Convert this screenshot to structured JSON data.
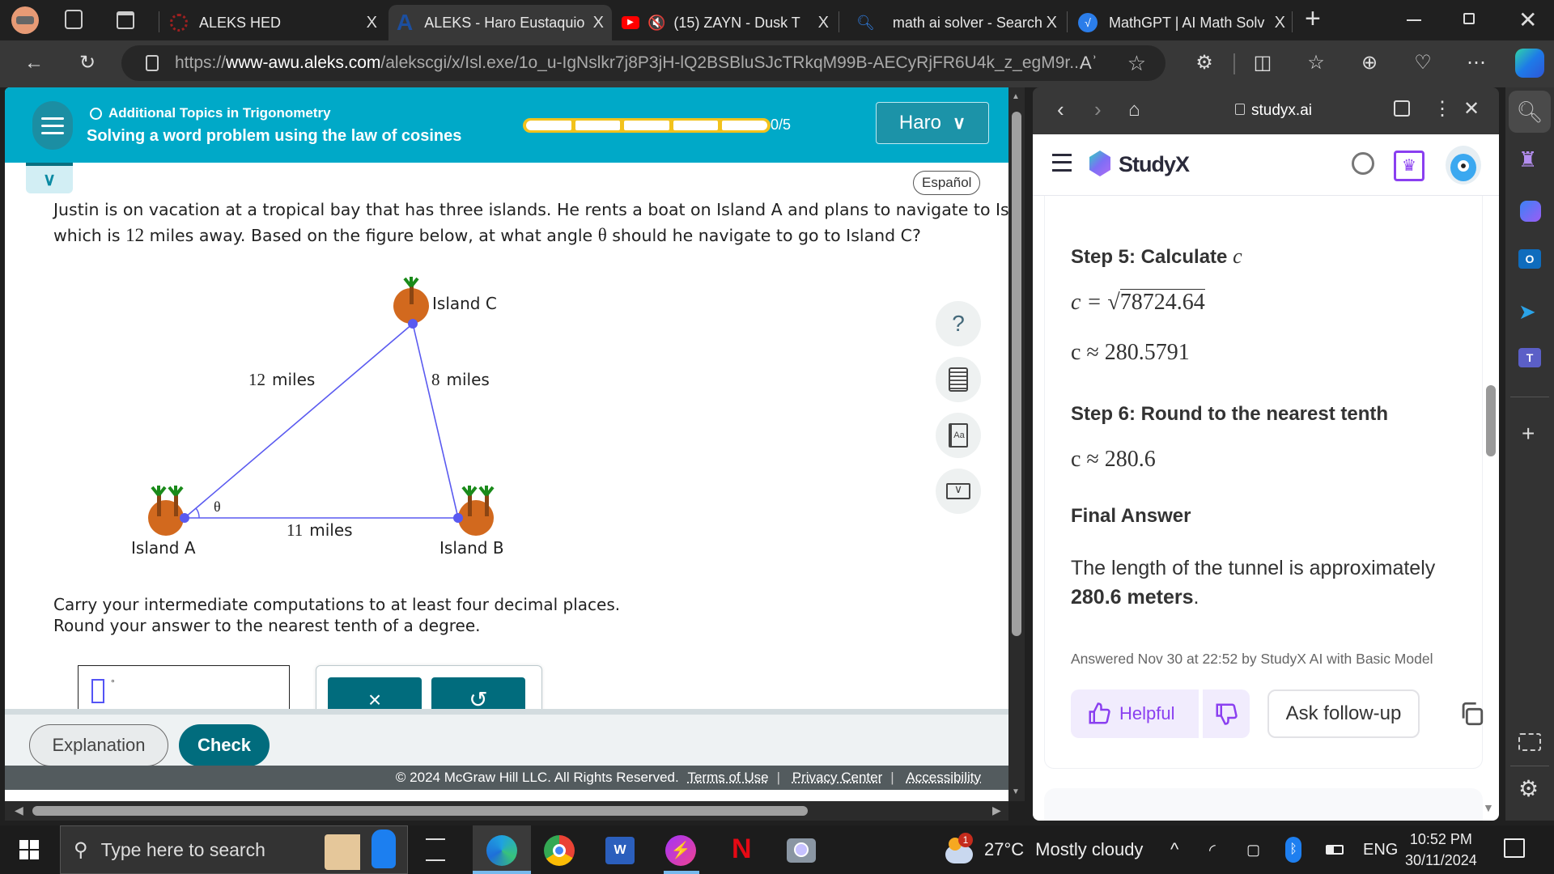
{
  "browser": {
    "tabs": [
      {
        "label": "ALEKS HED",
        "icon": "aleks-hed-icon",
        "active": false
      },
      {
        "label": "ALEKS - Haro Eustaquio",
        "icon": "aleks-a-icon",
        "active": true
      },
      {
        "label": "(15) ZAYN - Dusk T",
        "icon": "youtube-icon",
        "muted": true,
        "active": false
      },
      {
        "label": "math ai solver - Search",
        "icon": "bing-search-icon",
        "active": false
      },
      {
        "label": "MathGPT | AI Math Solv",
        "icon": "mathgpt-icon",
        "active": false
      }
    ],
    "new_tab": "+",
    "close_glyph": "X",
    "url_prefix": "https://",
    "url_domain": "www-awu.aleks.com",
    "url_path": "/alekscgi/x/Isl.exe/1o_u-IgNslkr7j8P3jH-lQ2BSBluSJcTRkqM99B-AECyRjFR6U4k_z_egM9r..."
  },
  "aleks": {
    "topic": "Additional Topics in Trigonometry",
    "lesson": "Solving a word problem using the law of cosines",
    "progress": {
      "done": 0,
      "total": 5,
      "label": "0/5"
    },
    "user_button": "Haro",
    "espanol": "Español",
    "question": {
      "line1": "Justin is on vacation at a tropical bay that has three islands. He rents a boat on Island A and plans to navigate to Island C,",
      "line2_pre": "which is ",
      "line2_num": "12",
      "line2_mid": " miles away. Based on the figure below, at what angle ",
      "line2_theta": "θ",
      "line2_post": " should he navigate to go to Island C?"
    },
    "figure": {
      "islands": [
        "Island A",
        "Island B",
        "Island C"
      ],
      "sides": [
        {
          "value": "12",
          "unit": "miles",
          "between": "A-C"
        },
        {
          "value": "8",
          "unit": "miles",
          "between": "B-C"
        },
        {
          "value": "11",
          "unit": "miles",
          "between": "A-B"
        }
      ],
      "angle_label": "θ",
      "colors": {
        "island": "#d2691e",
        "tree_trunk": "#8b4513",
        "tree_leaf": "#1a8a1a",
        "line": "#5a5af0"
      }
    },
    "instructions": [
      "Carry your intermediate computations to at least four decimal places.",
      "Round your answer to the nearest tenth of a degree."
    ],
    "answer": {
      "value": "",
      "unit": "°"
    },
    "tools": {
      "clear": "×",
      "undo": "↺"
    },
    "side_tools": [
      "help-icon",
      "calculator-icon",
      "dictionary-icon",
      "mail-icon"
    ],
    "buttons": {
      "explanation": "Explanation",
      "check": "Check"
    },
    "footer": {
      "copyright": "© 2024 McGraw Hill LLC. All Rights Reserved.",
      "links": [
        "Terms of Use",
        "Privacy Center",
        "Accessibility"
      ]
    }
  },
  "studyx": {
    "nav_url": "studyx.ai",
    "brand": "StudyX",
    "cut_line": "c  =  78724.64",
    "step5_title": "Step 5: Calculate ",
    "step5_var": "c",
    "eq1_lhs": "c = ",
    "eq1_rad": "78724.64",
    "eq2": "c ≈ 280.5791",
    "step6_title": "Step 6: Round to the nearest tenth",
    "eq3": "c ≈ 280.6",
    "final_title": "Final Answer",
    "final_text": "The length of the tunnel is approximately",
    "final_bold": "280.6 meters",
    "final_period": ".",
    "answered": "Answered Nov 30 at 22:52 by StudyX AI with Basic Model",
    "helpful": "Helpful",
    "followup": "Ask follow-up"
  },
  "taskbar": {
    "search_placeholder": "Type here to search",
    "weather_temp": "27°C",
    "weather_desc": "Mostly cloudy",
    "weather_badge": "1",
    "lang": "ENG",
    "time": "10:52 PM",
    "date": "30/11/2024"
  }
}
